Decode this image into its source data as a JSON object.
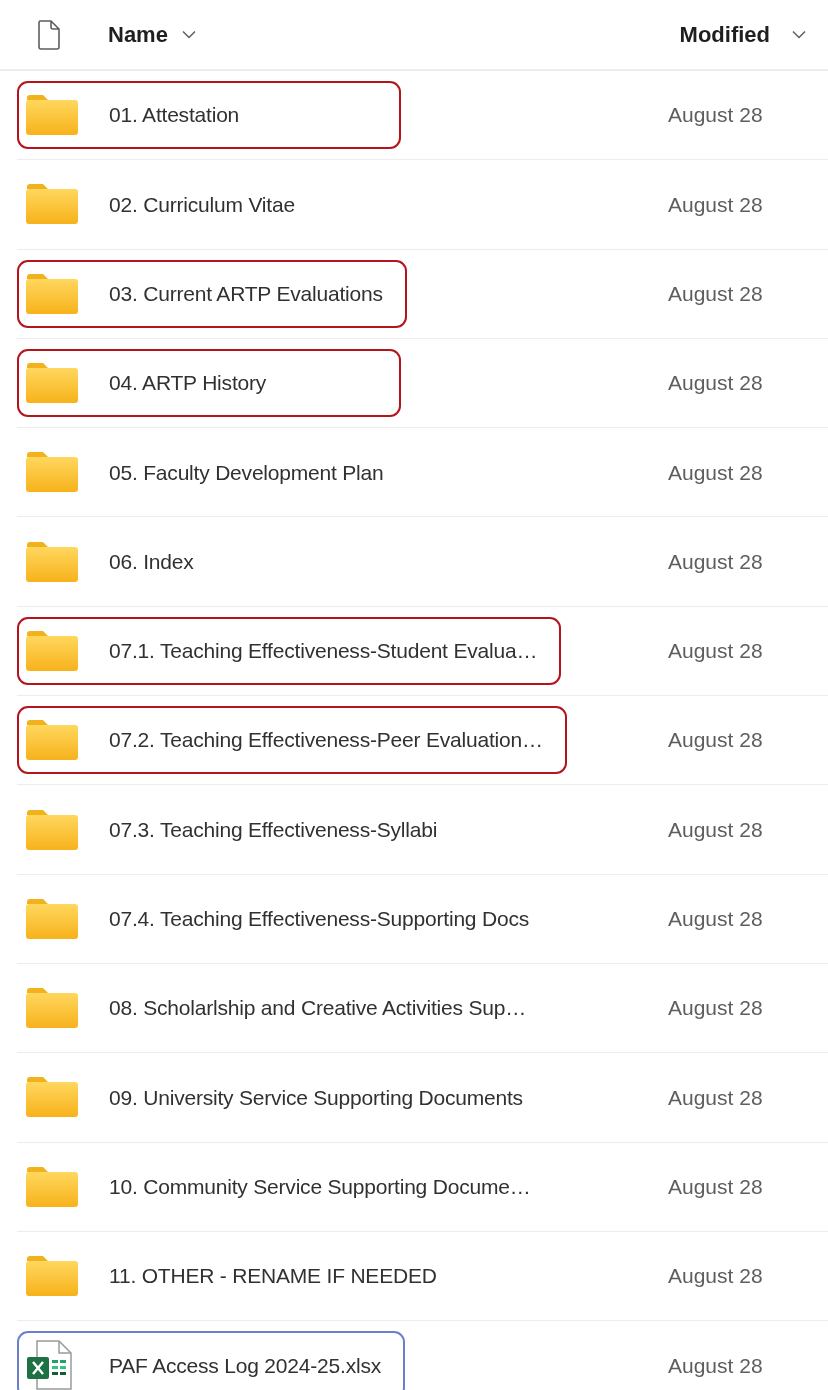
{
  "header": {
    "name_column": "Name",
    "modified_column": "Modified"
  },
  "rows": [
    {
      "kind": "folder",
      "name": "01. Attestation",
      "modified": "August 28",
      "color": "#b5141c"
    },
    {
      "kind": "folder",
      "name": "02. Curriculum Vitae",
      "modified": "August 28"
    },
    {
      "kind": "folder",
      "name": "03. Current ARTP Evaluations",
      "modified": "August 28",
      "color": "#b5141c"
    },
    {
      "kind": "folder",
      "name": "04. ARTP History",
      "modified": "August 28",
      "color": "#b5141c"
    },
    {
      "kind": "folder",
      "name": "05. Faculty Development Plan",
      "modified": "August 28"
    },
    {
      "kind": "folder",
      "name": "06. Index",
      "modified": "August 28"
    },
    {
      "kind": "folder",
      "name": "07.1. Teaching Effectiveness-Student Evalua…",
      "modified": "August 28",
      "color": "#b5141c"
    },
    {
      "kind": "folder",
      "name": "07.2. Teaching Effectiveness-Peer Evaluation…",
      "modified": "August 28",
      "color": "#b5141c"
    },
    {
      "kind": "folder",
      "name": "07.3. Teaching Effectiveness-Syllabi",
      "modified": "August 28"
    },
    {
      "kind": "folder",
      "name": "07.4. Teaching Effectiveness-Supporting Docs",
      "modified": "August 28"
    },
    {
      "kind": "folder",
      "name": "08. Scholarlship and Creative Activities Sup…",
      "modified": "August 28"
    },
    {
      "kind": "folder",
      "name": "09. University Service Supporting Documents",
      "modified": "August 28"
    },
    {
      "kind": "folder",
      "name": "10. Community Service Supporting Docume…",
      "modified": "August 28"
    },
    {
      "kind": "folder",
      "name": "11. OTHER - RENAME IF NEEDED",
      "modified": "August 28"
    },
    {
      "kind": "excel",
      "name": "PAF Access Log 2024-25.xlsx",
      "modified": "August 28",
      "color": "#6c7fcf"
    }
  ]
}
